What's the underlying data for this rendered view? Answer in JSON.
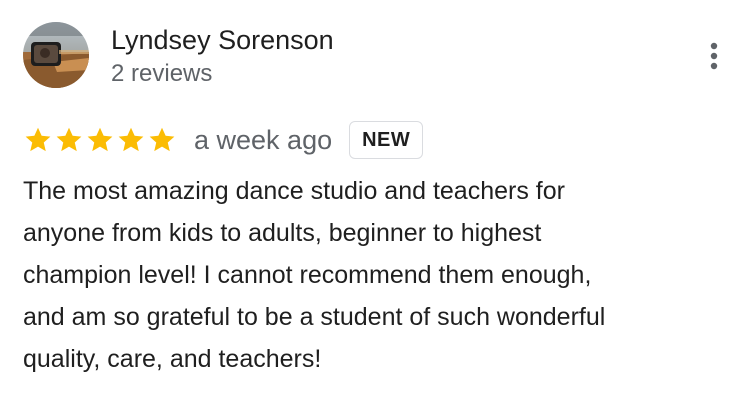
{
  "author": {
    "name": "Lyndsey Sorenson",
    "meta": "2 reviews"
  },
  "review": {
    "rating": 5,
    "rating_max": 5,
    "date": "a week ago",
    "badge": "NEW",
    "text_lines": [
      "The most amazing dance studio and teachers for",
      "anyone from kids to adults, beginner to highest",
      "champion level! I cannot recommend them enough,",
      "and am so grateful to be a student of such wonderful",
      "quality, care, and teachers!"
    ]
  },
  "icons": {
    "star": "star-icon",
    "more": "more-vert-icon"
  },
  "colors": {
    "star": "#fbbc04",
    "name": "#1f1f1f",
    "meta": "#5f6368",
    "badge_border": "#dadce0"
  }
}
